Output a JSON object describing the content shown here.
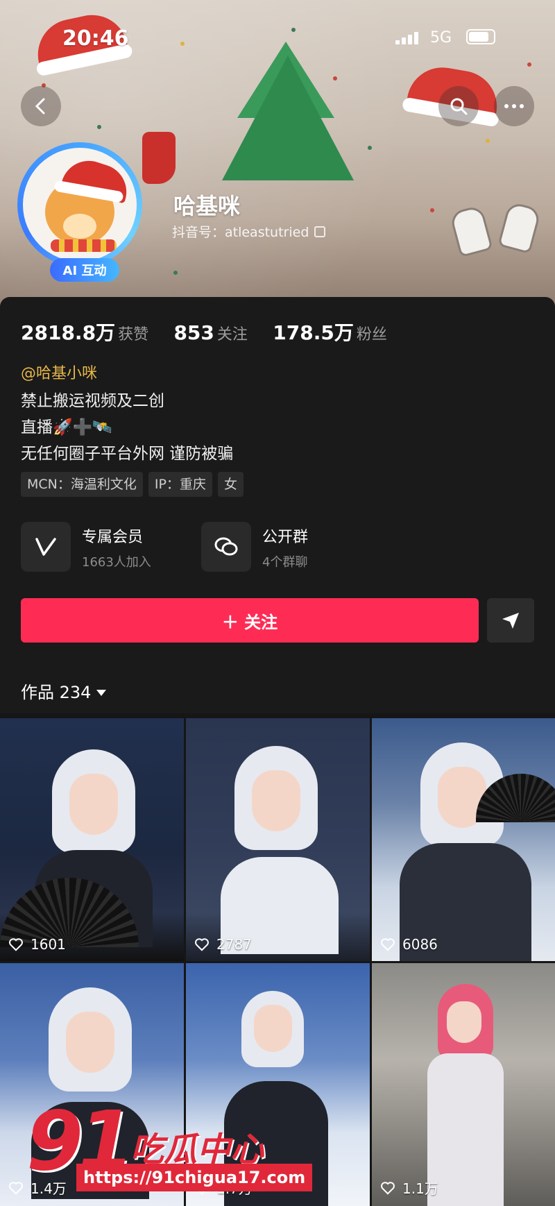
{
  "status_bar": {
    "time": "20:46",
    "network": "5G"
  },
  "profile": {
    "nickname": "哈基咪",
    "douyin_id": "抖音号：atleastutried",
    "ai_badge": "AI 互动"
  },
  "stats": [
    {
      "value": "2818.8万",
      "label": "获赞"
    },
    {
      "value": "853",
      "label": "关注"
    },
    {
      "value": "178.5万",
      "label": "粉丝"
    }
  ],
  "bio": {
    "handle": "@哈基小咪",
    "line1": "禁止搬运视频及二创",
    "line2": "直播🚀➕🛰️",
    "line3": "无任何圈子平台外网 谨防被骗"
  },
  "tags": [
    "MCN：海温利文化",
    "IP：重庆",
    "女"
  ],
  "features": [
    {
      "title": "专属会员",
      "subtitle": "1663人加入",
      "icon": "vip-icon"
    },
    {
      "title": "公开群",
      "subtitle": "4个群聊",
      "icon": "group-chat-icon"
    }
  ],
  "follow_label": "＋ 关注",
  "works": {
    "label": "作品 234"
  },
  "videos": [
    {
      "likes": "1601"
    },
    {
      "likes": "2787"
    },
    {
      "likes": "6086"
    },
    {
      "likes": "1.4万"
    },
    {
      "likes": "1.7万"
    },
    {
      "likes": "1.1万"
    }
  ],
  "watermark": {
    "number": "91",
    "text": "吃瓜中心",
    "url": "https://91chigua17.com"
  },
  "colors": {
    "follow": "#fe2c55",
    "handle": "#e8b84a",
    "panel": "#1a1a1a",
    "watermark": "#e0283a"
  }
}
